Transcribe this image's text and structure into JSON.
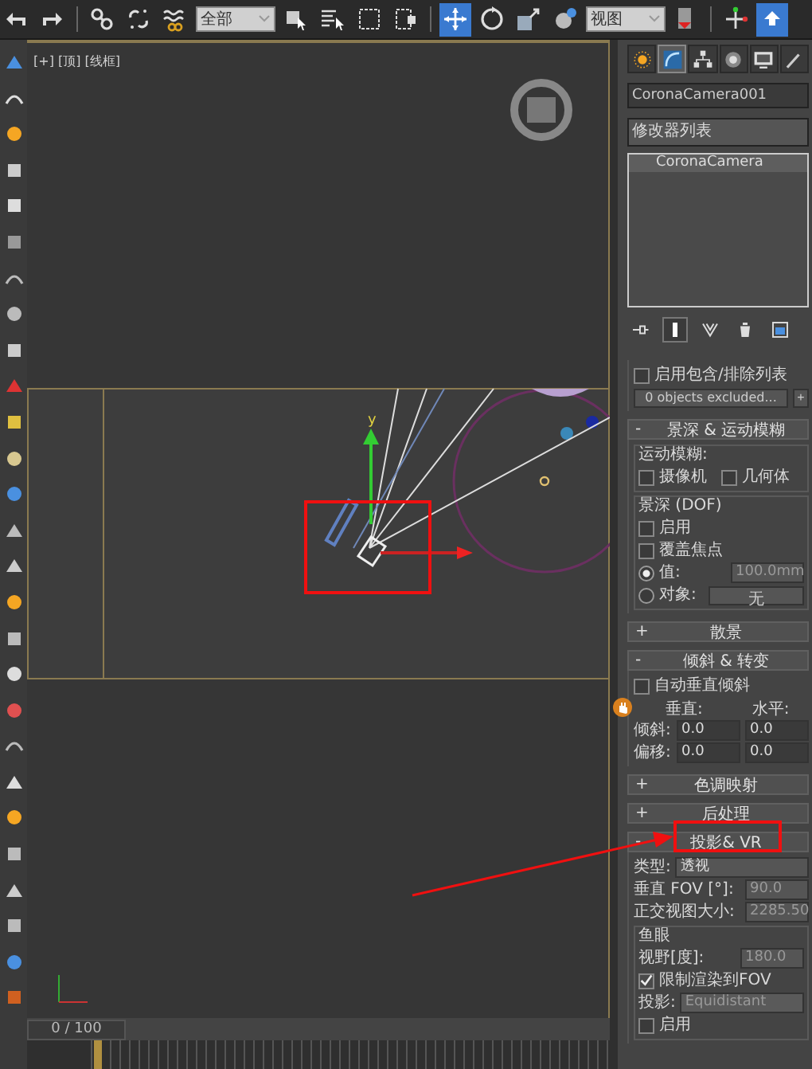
{
  "toolbar": [
    {
      "kind": "icon",
      "selected": false
    },
    {
      "kind": "icon",
      "selected": false
    },
    {
      "kind": "separator"
    },
    {
      "kind": "icon",
      "selected": false
    },
    {
      "kind": "icon",
      "selected": false
    },
    {
      "kind": "icon",
      "selected": false
    },
    {
      "kind": "dropdown",
      "value": "全部"
    },
    {
      "kind": "icon",
      "selected": false
    },
    {
      "kind": "icon",
      "selected": false
    },
    {
      "kind": "icon",
      "selected": false
    },
    {
      "kind": "icon",
      "selected": false
    },
    {
      "kind": "separator"
    },
    {
      "kind": "icon",
      "selected": true
    },
    {
      "kind": "icon",
      "selected": false
    },
    {
      "kind": "icon",
      "selected": false
    },
    {
      "kind": "icon",
      "selected": false
    },
    {
      "kind": "dropdown",
      "value": "视图"
    },
    {
      "kind": "icon",
      "selected": false
    },
    {
      "kind": "separator"
    },
    {
      "kind": "icon",
      "selected": false
    },
    {
      "kind": "icon",
      "selected": true
    }
  ],
  "viewport": {
    "label": "[+] [顶] [线框]",
    "gizmo_label": "y"
  },
  "time_slider": {
    "label": "0 / 100",
    "level": 0
  },
  "command_tabs": [
    {
      "selected": false
    },
    {
      "selected": true
    },
    {
      "selected": false
    },
    {
      "selected": false
    },
    {
      "selected": false
    },
    {
      "selected": false
    }
  ],
  "object_name": "CoronaCamera001",
  "modifier_list": "修改器列表",
  "stack": [
    {
      "label": "CoronaCamera",
      "selected": true
    }
  ],
  "stack_tools": [
    {
      "selected": false
    },
    {
      "selected": true
    },
    {
      "selected": false
    },
    {
      "selected": false
    },
    {
      "selected": false
    }
  ],
  "rollouts": [
    {
      "sections": [
        {
          "rows": [
            {
              "kind": "checkbox",
              "label": "启用包含/排除列表",
              "checked": false
            },
            {
              "kind": "button",
              "label": "0 objects excluded...",
              "side": "+"
            }
          ]
        }
      ]
    },
    {
      "toggle": "-",
      "title": "景深 & 运动模糊",
      "sections": [
        {
          "title": "运动模糊:",
          "rows": [
            {
              "kind": "checkbox_pair",
              "items": [
                {
                  "label": "摄像机",
                  "checked": false
                },
                {
                  "label": "几何体",
                  "checked": false
                }
              ]
            }
          ]
        },
        {
          "title": "景深 (DOF)",
          "rows": [
            {
              "kind": "checkbox",
              "label": "启用",
              "checked": false
            },
            {
              "kind": "checkbox",
              "label": "覆盖焦点",
              "checked": false
            },
            {
              "kind": "radio_spinner",
              "label": "值:",
              "selected": true,
              "value": "100.0mm",
              "disabled": true
            },
            {
              "kind": "radio_button",
              "label": "对象:",
              "selected": false,
              "button": "无"
            }
          ]
        }
      ]
    },
    {
      "toggle": "+",
      "title": "散景"
    },
    {
      "toggle": "-",
      "title": "倾斜 & 转变",
      "sections": [
        {
          "rows": [
            {
              "kind": "checkbox",
              "label": "自动垂直倾斜",
              "checked": false
            },
            {
              "kind": "column_heads",
              "labels": [
                "垂直:",
                "水平:"
              ]
            },
            {
              "kind": "spinner_pair",
              "label": "倾斜:",
              "values": [
                "0.0",
                "0.0"
              ]
            },
            {
              "kind": "spinner_pair",
              "label": "偏移:",
              "values": [
                "0.0",
                "0.0"
              ]
            }
          ]
        }
      ]
    },
    {
      "toggle": "+",
      "title": "色调映射"
    },
    {
      "toggle": "+",
      "title": "后处理"
    },
    {
      "toggle": "-",
      "title": "投影& VR",
      "sections": [
        {
          "rows": [
            {
              "kind": "dropdown",
              "label": "类型:",
              "value": "透视",
              "disabled": false
            },
            {
              "kind": "spinner",
              "label": "垂直 FOV [°]:",
              "value": "90.0",
              "disabled": true
            },
            {
              "kind": "spinner",
              "label": "正交视图大小:",
              "value": "2285.50",
              "disabled": true
            }
          ]
        },
        {
          "title": "鱼眼",
          "rows": [
            {
              "kind": "spinner",
              "label": "视野[度]:",
              "value": "180.0",
              "disabled": true
            },
            {
              "kind": "checkbox",
              "label": "限制渲染到FOV",
              "checked": true
            },
            {
              "kind": "dropdown",
              "label": "投影:",
              "value": "Equidistant",
              "disabled": true
            },
            {
              "kind": "checkbox",
              "label": "启用",
              "checked": false
            }
          ]
        }
      ]
    }
  ]
}
